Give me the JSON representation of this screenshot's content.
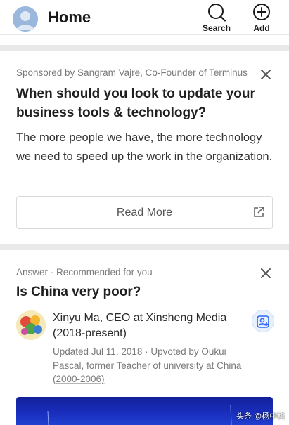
{
  "header": {
    "title": "Home",
    "search_label": "Search",
    "add_label": "Add"
  },
  "sponsored_card": {
    "sponsor_text": "Sponsored by Sangram Vajre, Co-Founder of Terminus",
    "title": "When should you look to update your business tools & technology?",
    "body": "The more people we have, the more technology we need to speed up the work in the organization.",
    "cta_label": "Read More"
  },
  "answer_card": {
    "meta": "Answer · Recommended for you",
    "question": "Is China very poor?",
    "author": "Xinyu Ma, CEO at Xinsheng Media (2018-present)",
    "updated": "Updated Jul 11, 2018 · Upvoted by Oukui Pascal, ",
    "upvoter_credential": "former Teacher of university at China (2000-2006)"
  },
  "watermark": "头条 @杨中科",
  "colors": {
    "accent": "#2e69ff",
    "separator": "#e9e9e9",
    "muted_text": "#7a7a7a"
  }
}
